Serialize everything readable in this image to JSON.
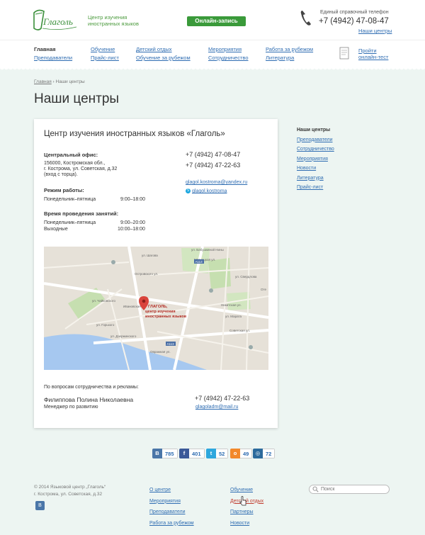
{
  "header": {
    "logo_text": "Глаголь",
    "tagline": "Центр изучения иностранных языков",
    "online_button": "Онлайн-запись",
    "phone_label": "Единый справочный телефон",
    "phone": "+7 (4942) 47-08-47",
    "centers_link": "Наши центры"
  },
  "nav": {
    "col1": [
      "Главная",
      "Преподаватели"
    ],
    "col2": [
      "Обучение",
      "Прайс-лист"
    ],
    "col3": [
      "Детский отдых",
      "Обучение за рубежом"
    ],
    "col4": [
      "Мероприятия",
      "Сотрудничество"
    ],
    "col5": [
      "Работа за рубежом",
      "Литература"
    ],
    "test_link": [
      "Пройти",
      "онлайн-тест"
    ]
  },
  "breadcrumb": {
    "home": "Главная",
    "sep": " › ",
    "current": "Наши центры"
  },
  "page_title": "Наши центры",
  "card": {
    "title": "Центр изучения иностранных языков «Глаголь»",
    "office_label": "Центральный офис:",
    "address": [
      "156000, Костромская обл.,",
      "г. Кострома, ул. Советская, д.32",
      "(вход с торца)."
    ],
    "phones": [
      "+7 (4942) 47-08-47",
      "+7 (4942) 47-22-63"
    ],
    "email": "glagol.kostroma@yandex.ru",
    "skype": "glagol.kostroma",
    "skype_icon_letter": "S",
    "work_label": "Режим работы:",
    "work_days": "Понедельник–пятница",
    "work_hours": "9:00–18:00",
    "classes_label": "Время проведения занятий:",
    "classes": [
      {
        "days": "Понедельник–пятница",
        "hours": "9:00–20:00"
      },
      {
        "days": "Выходные",
        "hours": "10:00–18:00"
      }
    ],
    "map": {
      "marker_label": [
        "ГЛАГОЛЬ,",
        "центр изучения",
        "иностранных языков"
      ],
      "streets": [
        "ул. Шагова",
        "ул. Бабушкиной Нины",
        "Мясницкая ул.",
        "Никитская ул.",
        "Советская ул.",
        "ул. Свердлова",
        "ул. Чайковского",
        "ул. Горького",
        "ул. Дзержинского",
        "Ивановская ул.",
        "Островского ул.",
        "Овражная ул.",
        "ул. Марата"
      ],
      "badges": [
        "A113",
        "A113"
      ],
      "side_label": "Оте"
    },
    "coop_label": "По вопросам сотрудничества и рекламы:",
    "contact_name": "Филиппова Полина Николаевна",
    "contact_role": "Менеджер по развитию",
    "contact_phone": "+7 (4942) 47-22-63",
    "contact_email": "glagoladm@mail.ru"
  },
  "sidebar": {
    "title": "Наши центры",
    "items": [
      "Преподаватели",
      "Сотрудничество",
      "Мероприятия",
      "Новости",
      "Литература",
      "Прайс-лист"
    ]
  },
  "social": [
    {
      "icon": "В",
      "count": "785",
      "color": "#4a76a8"
    },
    {
      "icon": "f",
      "count": "401",
      "color": "#3b5998"
    },
    {
      "icon": "t",
      "count": "52",
      "color": "#2fa7dd"
    },
    {
      "icon": "о",
      "count": "49",
      "color": "#f2892b"
    },
    {
      "icon": "◎",
      "count": "72",
      "color": "#2c6a9c"
    }
  ],
  "footer": {
    "copyright": [
      "© 2014 Языковой центр „Глаголь“",
      "г. Кострома, ул. Советская, д.32"
    ],
    "vk_icon": "В",
    "col1": [
      "О центре",
      "Мероприятия",
      "Преподаватели",
      "Работа за рубежом"
    ],
    "col2": [
      "Обучение",
      "Детский отдых",
      "Партнеры",
      "Новости"
    ],
    "search_placeholder": "Поиск"
  },
  "colors": {
    "link": "#2f6db2",
    "accent_green": "#3a9a3a",
    "background": "#edf5f2",
    "map_water": "#a6c8f0",
    "marker": "#d9443c"
  }
}
